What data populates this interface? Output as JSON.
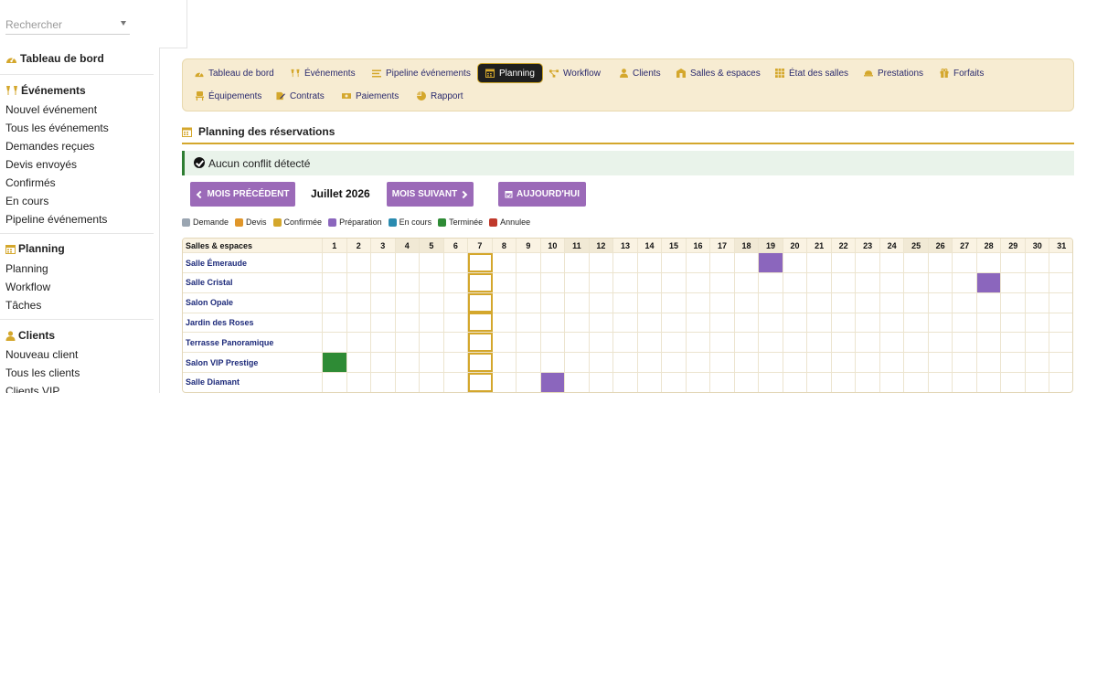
{
  "search": {
    "placeholder": "Rechercher"
  },
  "sidebar": {
    "dashboard": "Tableau de bord",
    "events_head": "Événements",
    "events_items": [
      "Nouvel événement",
      "Tous les événements",
      "Demandes reçues",
      "Devis envoyés",
      "Confirmés",
      "En cours",
      "Pipeline événements"
    ],
    "planning_head": "Planning",
    "planning_items": [
      "Planning",
      "Workflow",
      "Tâches"
    ],
    "clients_head": "Clients",
    "clients_items": [
      "Nouveau client",
      "Tous les clients",
      "Clients VIP"
    ]
  },
  "tabs": [
    {
      "label": "Tableau de bord",
      "icon": "gauge-icon"
    },
    {
      "label": "Événements",
      "icon": "glasses-icon"
    },
    {
      "label": "Pipeline événements",
      "icon": "bars-icon"
    },
    {
      "label": "Planning",
      "icon": "calendar-icon",
      "active": true
    },
    {
      "label": "Workflow",
      "icon": "workflow-icon"
    },
    {
      "label": "Clients",
      "icon": "user-icon"
    },
    {
      "label": "Salles & espaces",
      "icon": "building-icon"
    },
    {
      "label": "État des salles",
      "icon": "grid-icon"
    },
    {
      "label": "Prestations",
      "icon": "cloche-icon"
    },
    {
      "label": "Forfaits",
      "icon": "gift-icon"
    },
    {
      "label": "Équipements",
      "icon": "chair-icon"
    },
    {
      "label": "Contrats",
      "icon": "contract-icon"
    },
    {
      "label": "Paiements",
      "icon": "money-icon"
    },
    {
      "label": "Rapport",
      "icon": "pie-icon"
    }
  ],
  "page": {
    "title": "Planning des réservations",
    "alert": "Aucun conflit détecté",
    "prev_button": "MOIS PRÉCÉDENT",
    "next_button": "MOIS SUIVANT",
    "today_button": "AUJOURD'HUI",
    "month": "Juillet 2026"
  },
  "legend": [
    {
      "label": "Demande",
      "color": "#9aa5b1"
    },
    {
      "label": "Devis",
      "color": "#e0962a"
    },
    {
      "label": "Confirmée",
      "color": "#d4a72c"
    },
    {
      "label": "Préparation",
      "color": "#8b66bd"
    },
    {
      "label": "En cours",
      "color": "#2a8bb0"
    },
    {
      "label": "Terminée",
      "color": "#2e8b35"
    },
    {
      "label": "Annulee",
      "color": "#c0392b"
    }
  ],
  "grid": {
    "header_label": "Salles & espaces",
    "days": [
      "1",
      "2",
      "3",
      "4",
      "5",
      "6",
      "7",
      "8",
      "9",
      "10",
      "11",
      "12",
      "13",
      "14",
      "15",
      "16",
      "17",
      "18",
      "19",
      "20",
      "21",
      "22",
      "23",
      "24",
      "25",
      "26",
      "27",
      "28",
      "29",
      "30",
      "31"
    ],
    "weekend_days": [
      4,
      5,
      11,
      12,
      18,
      19,
      25,
      26
    ],
    "today": 7,
    "rooms": [
      {
        "name": "Salle Émeraude",
        "bookings": [
          {
            "day": 19,
            "status": "prep"
          }
        ]
      },
      {
        "name": "Salle Cristal",
        "bookings": [
          {
            "day": 28,
            "status": "prep"
          }
        ]
      },
      {
        "name": "Salon Opale",
        "bookings": []
      },
      {
        "name": "Jardin des Roses",
        "bookings": []
      },
      {
        "name": "Terrasse Panoramique",
        "bookings": []
      },
      {
        "name": "Salon VIP Prestige",
        "bookings": [
          {
            "day": 1,
            "status": "done"
          }
        ]
      },
      {
        "name": "Salle Diamant",
        "bookings": [
          {
            "day": 10,
            "status": "prep"
          }
        ]
      }
    ]
  }
}
